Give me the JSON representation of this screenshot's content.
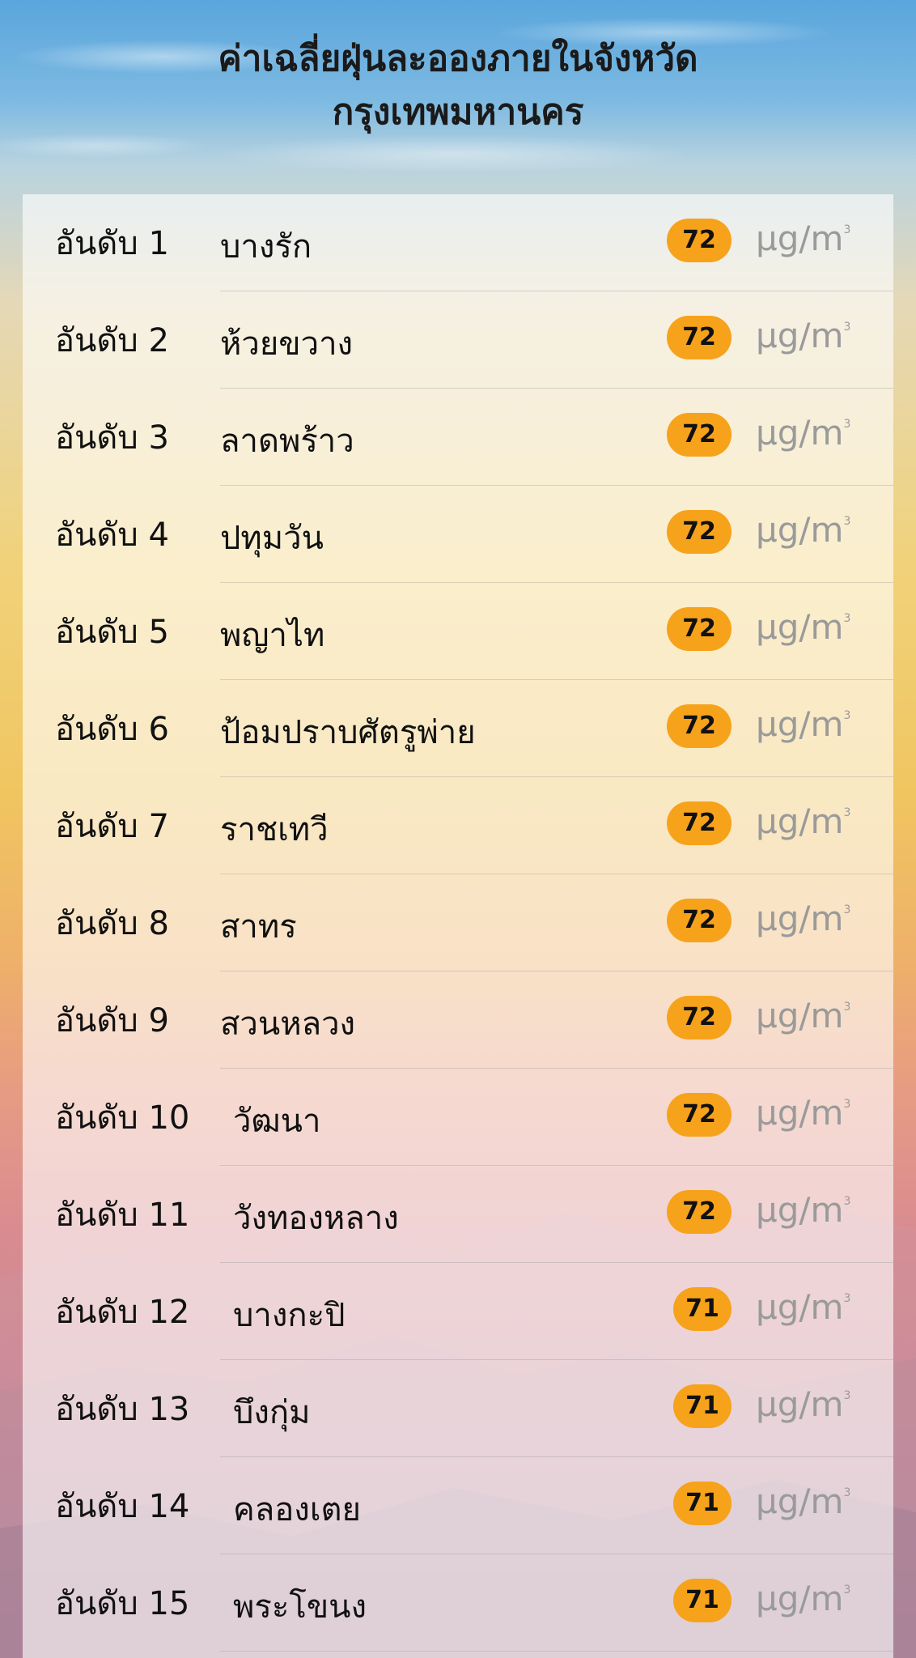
{
  "header": {
    "title_line1": "ค่าเฉลี่ยฝุ่นละอองภายในจังหวัด",
    "title_line2": "กรุงเทพมหานคร"
  },
  "rank_prefix": "อันดับ",
  "unit": {
    "base": "μg/m",
    "exp": "3"
  },
  "rows": [
    {
      "rank": "1",
      "district": "บางรัก",
      "value": "72"
    },
    {
      "rank": "2",
      "district": "ห้วยขวาง",
      "value": "72"
    },
    {
      "rank": "3",
      "district": "ลาดพร้าว",
      "value": "72"
    },
    {
      "rank": "4",
      "district": "ปทุมวัน",
      "value": "72"
    },
    {
      "rank": "5",
      "district": "พญาไท",
      "value": "72"
    },
    {
      "rank": "6",
      "district": "ป้อมปราบศัตรูพ่าย",
      "value": "72"
    },
    {
      "rank": "7",
      "district": "ราชเทวี",
      "value": "72"
    },
    {
      "rank": "8",
      "district": "สาทร",
      "value": "72"
    },
    {
      "rank": "9",
      "district": "สวนหลวง",
      "value": "72"
    },
    {
      "rank": "10",
      "district": "วัฒนา",
      "value": "72"
    },
    {
      "rank": "11",
      "district": "วังทองหลาง",
      "value": "72"
    },
    {
      "rank": "12",
      "district": "บางกะปิ",
      "value": "71"
    },
    {
      "rank": "13",
      "district": "บึงกุ่ม",
      "value": "71"
    },
    {
      "rank": "14",
      "district": "คลองเตย",
      "value": "71"
    },
    {
      "rank": "15",
      "district": "พระโขนง",
      "value": "71"
    }
  ],
  "colors": {
    "badge": "#f7a21b",
    "text": "#111111",
    "unit": "#9a9a9a"
  }
}
